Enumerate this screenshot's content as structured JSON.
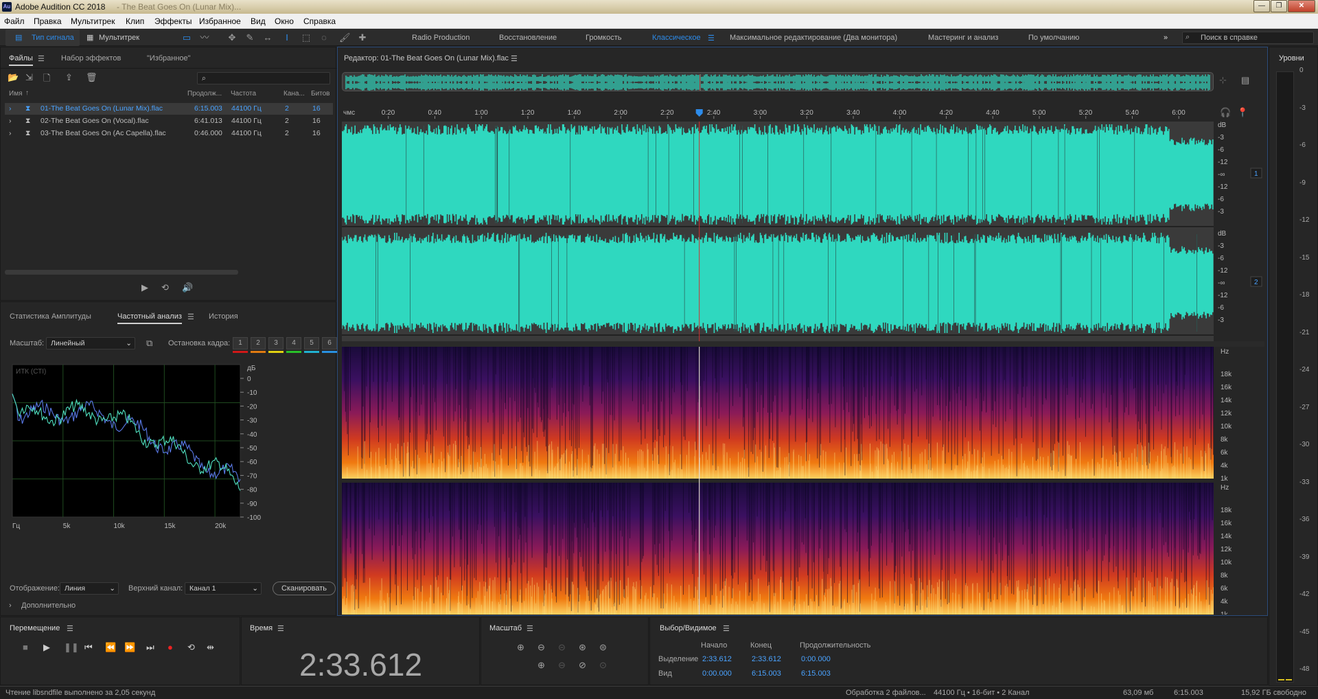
{
  "window": {
    "title": "Adobe Audition CC 2018",
    "title_suffix": "- The Beat Goes On (Lunar Mix)...",
    "logo": "Au"
  },
  "menu": [
    "Файл",
    "Правка",
    "Мультитрек",
    "Клип",
    "Эффекты",
    "Избранное",
    "Вид",
    "Окно",
    "Справка"
  ],
  "toolbar": {
    "waveform_label": "Тип сигнала",
    "multitrack_label": "Мультитрек",
    "search_placeholder": "Поиск в справке"
  },
  "workspaces": [
    "Radio Production",
    "Восстановление",
    "Громкость",
    "Классическое",
    "Максимальное редактирование (Два монитора)",
    "Мастеринг и анализ",
    "По умолчанию"
  ],
  "files_panel": {
    "tabs": [
      "Файлы",
      "Набор эффектов",
      "\"Избранное\""
    ],
    "columns": [
      "Имя",
      "Продолж...",
      "Частота",
      "Кана...",
      "Битов"
    ],
    "rows": [
      {
        "name": "01-The Beat Goes On (Lunar Mix).flac",
        "duration": "6:15.003",
        "rate": "44100 Гц",
        "ch": "2",
        "bits": "16",
        "selected": true
      },
      {
        "name": "02-The Beat Goes On (Vocal).flac",
        "duration": "6:41.013",
        "rate": "44100 Гц",
        "ch": "2",
        "bits": "16",
        "selected": false
      },
      {
        "name": "03-The Beat Goes On (Ac Capella).flac",
        "duration": "0:46.000",
        "rate": "44100 Гц",
        "ch": "2",
        "bits": "16",
        "selected": false
      }
    ]
  },
  "analysis_panel": {
    "tabs": [
      "Статистика Амплитуды",
      "Частотный анализ",
      "История"
    ],
    "scale_label": "Масштаб:",
    "scale_value": "Линейный",
    "freeze_label": "Остановка кадра:",
    "freeze_buttons": [
      "1",
      "2",
      "3",
      "4",
      "5",
      "6"
    ],
    "freeze_colors": [
      "#d01818",
      "#e07a10",
      "#e0d010",
      "#28c028",
      "#20b0d0",
      "#2890e0"
    ],
    "graph_label": "ИТК (СТI)",
    "y_unit": "дБ",
    "y_ticks": [
      "0",
      "-10",
      "-20",
      "-30",
      "-40",
      "-50",
      "-60",
      "-70",
      "-80",
      "-90",
      "-100"
    ],
    "x_ticks": [
      "Гц",
      "5k",
      "10k",
      "15k",
      "20k"
    ],
    "display_label": "Отображение:",
    "display_value": "Линия",
    "channel_label": "Верхний канал:",
    "channel_value": "Канал 1",
    "scan_label": "Сканировать",
    "more_label": "Дополнительно"
  },
  "editor": {
    "title": "Редактор: 01-The Beat Goes On (Lunar Mix).flac",
    "ruler_unit": "чмс",
    "ruler": [
      "0:20",
      "0:40",
      "1:00",
      "1:20",
      "1:40",
      "2:00",
      "2:20",
      "2:40",
      "3:00",
      "3:20",
      "3:40",
      "4:00",
      "4:20",
      "4:40",
      "5:00",
      "5:20",
      "5:40",
      "6:00"
    ],
    "db_scale": [
      "dB",
      "-3",
      "-6",
      "-12",
      "-∞",
      "-12",
      "-6",
      "-3"
    ],
    "hz_scale": [
      "Hz",
      "18k",
      "16k",
      "14k",
      "12k",
      "10k",
      "8k",
      "6k",
      "4k",
      "1k"
    ],
    "channels": [
      "1",
      "2"
    ],
    "playhead_fraction": 0.41,
    "wave_color": "#2fd8bf"
  },
  "levels": {
    "title": "Уровни",
    "ticks": [
      "0",
      "-3",
      "-6",
      "-9",
      "-12",
      "-15",
      "-18",
      "-21",
      "-24",
      "-27",
      "-30",
      "-33",
      "-36",
      "-39",
      "-42",
      "-45",
      "-48"
    ]
  },
  "transport": {
    "title": "Перемещение"
  },
  "time": {
    "title": "Время",
    "value": "2:33.612"
  },
  "zoom": {
    "title": "Масштаб"
  },
  "selection": {
    "title": "Выбор/Видимое",
    "headers": [
      "Начало",
      "Конец",
      "Продолжительность"
    ],
    "rows": [
      {
        "label": "Выделение",
        "start": "2:33.612",
        "end": "2:33.612",
        "dur": "0:00.000"
      },
      {
        "label": "Вид",
        "start": "0:00.000",
        "end": "6:15.003",
        "dur": "6:15.003"
      }
    ]
  },
  "status": {
    "message": "Чтение libsndfile выполнено за 2,05 секунд",
    "processing": "Обработка 2 файлов...",
    "format": "44100 Гц • 16-бит • 2 Канал",
    "size": "63,09 мб",
    "duration": "6:15.003",
    "free": "15,92 ГБ свободно"
  }
}
